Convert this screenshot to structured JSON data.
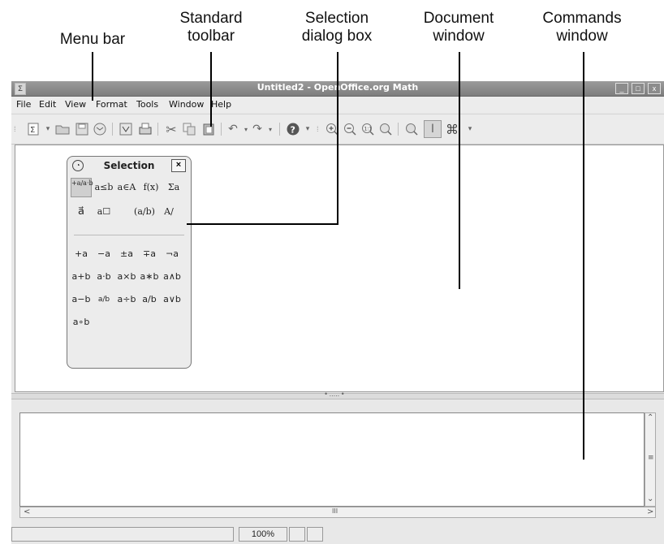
{
  "callouts": {
    "menu_bar": "Menu bar",
    "standard_toolbar": "Standard\ntoolbar",
    "selection_dialog": "Selection\ndialog box",
    "document_window": "Document\nwindow",
    "commands_window": "Commands\nwindow"
  },
  "window": {
    "title": "Untitled2 - OpenOffice.org Math",
    "sys_icon": "Σ",
    "controls": [
      "_",
      "□",
      "x"
    ]
  },
  "menu": [
    "File",
    "Edit",
    "View",
    "Format",
    "Tools",
    "Window",
    "Help"
  ],
  "toolbar_icons": [
    "new-icon",
    "open-icon",
    "save-icon",
    "email-icon",
    "export-pdf-icon",
    "print-icon",
    "cut-icon",
    "copy-icon",
    "paste-icon",
    "undo-icon",
    "redo-icon",
    "help-icon",
    "zoom-in-icon",
    "zoom-out-icon",
    "zoom-100-icon",
    "show-all-icon",
    "update-icon",
    "formula-cursor-icon",
    "symbols-icon"
  ],
  "selection": {
    "title": "Selection",
    "close": "×",
    "categories": [
      "+a/a·b",
      "a≤b",
      "a∈A",
      "f(x)",
      "Σa",
      "a⃗",
      "a☐",
      "(a/b)",
      "A/"
    ],
    "symbols": [
      [
        "+a",
        "−a",
        "±a",
        "∓a",
        "¬a"
      ],
      [
        "a+b",
        "a·b",
        "a×b",
        "a∗b",
        "a∧b"
      ],
      [
        "a−b",
        "a/b",
        "a÷b",
        "a/b",
        "a∨b"
      ],
      [
        "a∘b"
      ]
    ]
  },
  "commands": {
    "hscroll_thumb": "III"
  },
  "status": {
    "zoom": "100%"
  }
}
